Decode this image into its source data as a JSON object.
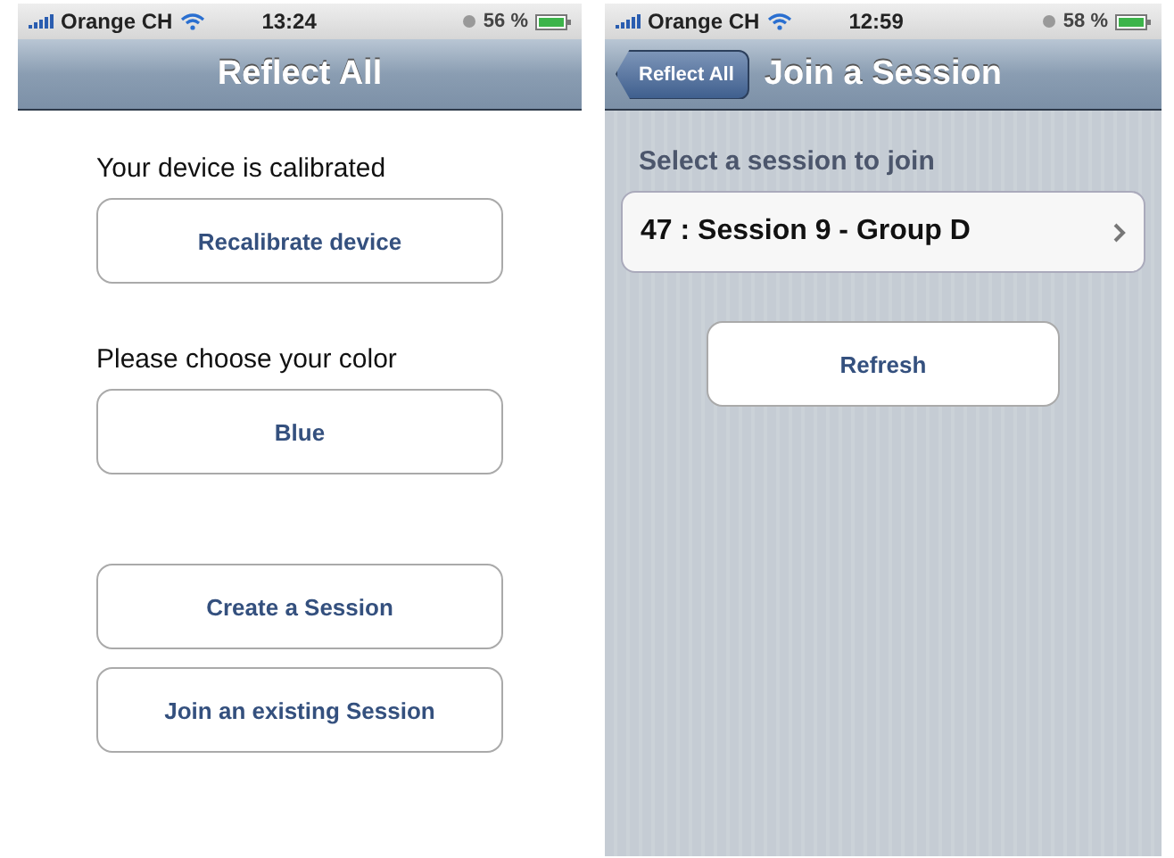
{
  "screens": [
    {
      "kind": "menu",
      "status_bar": {
        "carrier": "Orange CH",
        "time": "13:24",
        "battery": "56 %"
      },
      "nav_bar": {
        "title": "Reflect All"
      },
      "items": [
        {
          "kind": "text",
          "text": "Your device is calibrated"
        },
        {
          "kind": "button",
          "label": "Recalibrate device"
        },
        {
          "kind": "text",
          "text": "Please choose your color"
        },
        {
          "kind": "button",
          "label": "Blue"
        },
        {
          "kind": "spacer"
        },
        {
          "kind": "button",
          "label": "Create a Session"
        },
        {
          "kind": "button",
          "label": "Join an existing Session"
        }
      ]
    },
    {
      "kind": "list",
      "status_bar": {
        "carrier": "Orange CH",
        "time": "12:59",
        "battery": "58 %"
      },
      "nav_bar": {
        "back": "Reflect All",
        "title": "Join a Session"
      },
      "section_header": "Select a session to join",
      "sessions": [
        {
          "label": "47 : Session 9 - Group D"
        }
      ],
      "button": "Refresh"
    }
  ]
}
